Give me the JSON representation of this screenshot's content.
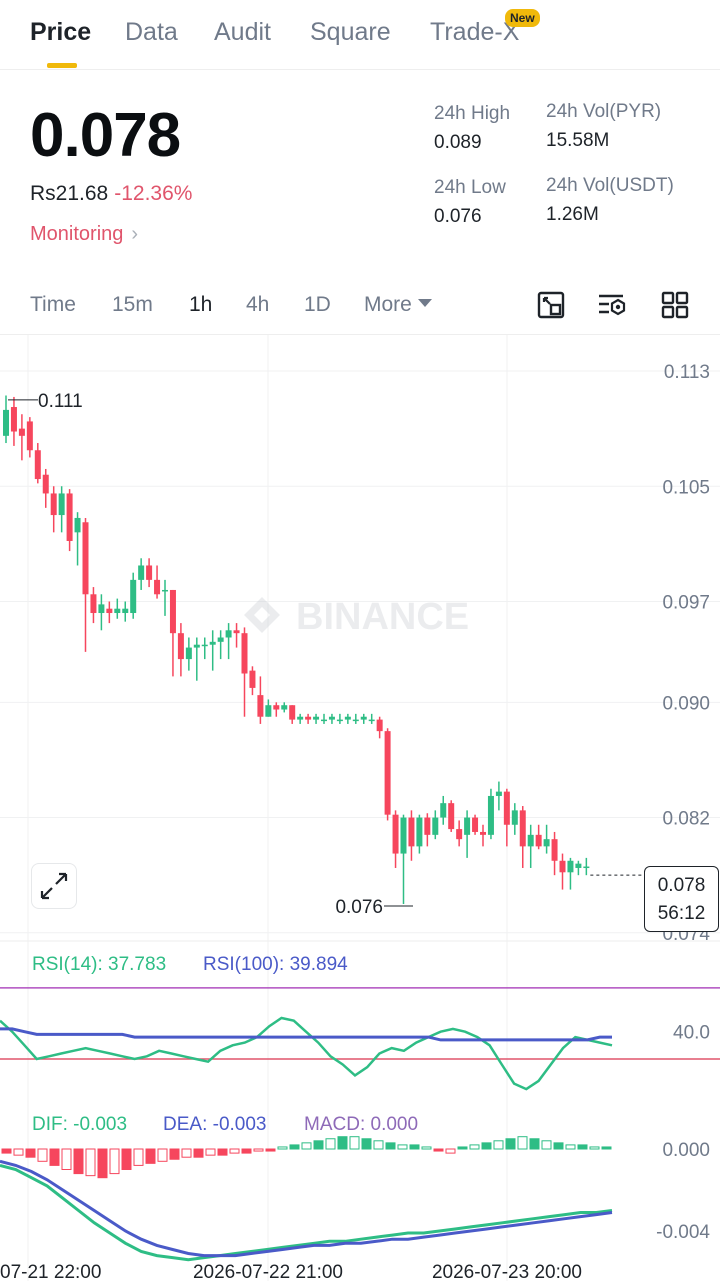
{
  "tabs": [
    {
      "label": "Price",
      "active": true
    },
    {
      "label": "Data",
      "active": false
    },
    {
      "label": "Audit",
      "active": false
    },
    {
      "label": "Square",
      "active": false
    },
    {
      "label": "Trade-X",
      "active": false
    }
  ],
  "new_badge": "New",
  "price": {
    "last": "0.078",
    "fiat": "Rs21.68",
    "change": "-12.36%",
    "monitoring": "Monitoring"
  },
  "stats": {
    "high_label": "24h High",
    "high_value": "0.089",
    "low_label": "24h Low",
    "low_value": "0.076",
    "vol_base_label": "24h Vol(PYR)",
    "vol_base_value": "15.58M",
    "vol_quote_label": "24h Vol(USDT)",
    "vol_quote_value": "1.26M"
  },
  "intervals": [
    {
      "label": "Time",
      "active": false
    },
    {
      "label": "15m",
      "active": false
    },
    {
      "label": "1h",
      "active": true
    },
    {
      "label": "4h",
      "active": false
    },
    {
      "label": "1D",
      "active": false
    },
    {
      "label": "More",
      "active": false
    }
  ],
  "icons": {
    "tool_1": "crop-icon",
    "tool_2": "indicator-settings-icon",
    "tool_3": "grid-layout-icon",
    "expand": "expand-icon"
  },
  "colors": {
    "up": "#2ebd85",
    "down": "#f6465d",
    "accent": "#f0b90b",
    "rsi14": "#2ebd85",
    "rsi100": "#4a5ac8",
    "macd": "#8e6ab8"
  },
  "chart_data": {
    "type": "candlestick",
    "interval": "1h",
    "watermark": "BINANCE",
    "y_ticks": [
      "0.113",
      "0.105",
      "0.097",
      "0.090",
      "0.082",
      "0.074"
    ],
    "ylim": [
      0.0735,
      0.1155
    ],
    "high_marker": "0.111",
    "low_marker": "0.076",
    "last_price_tag": "0.078",
    "countdown": "56:12",
    "x_ticks": [
      "07-21 22:00",
      "2026-07-22 21:00",
      "2026-07-23 20:00"
    ],
    "candles": [
      {
        "o": 0.1085,
        "h": 0.1113,
        "l": 0.108,
        "c": 0.1103
      },
      {
        "o": 0.1105,
        "h": 0.1112,
        "l": 0.1078,
        "c": 0.1088
      },
      {
        "o": 0.109,
        "h": 0.11,
        "l": 0.1068,
        "c": 0.1085
      },
      {
        "o": 0.1095,
        "h": 0.1098,
        "l": 0.107,
        "c": 0.1075
      },
      {
        "o": 0.1075,
        "h": 0.108,
        "l": 0.1052,
        "c": 0.1055
      },
      {
        "o": 0.1058,
        "h": 0.1062,
        "l": 0.1035,
        "c": 0.1045
      },
      {
        "o": 0.1045,
        "h": 0.105,
        "l": 0.1018,
        "c": 0.103
      },
      {
        "o": 0.103,
        "h": 0.105,
        "l": 0.1018,
        "c": 0.1045
      },
      {
        "o": 0.1045,
        "h": 0.1048,
        "l": 0.1005,
        "c": 0.1012
      },
      {
        "o": 0.1018,
        "h": 0.1032,
        "l": 0.0995,
        "c": 0.1028
      },
      {
        "o": 0.1025,
        "h": 0.1028,
        "l": 0.0935,
        "c": 0.0975
      },
      {
        "o": 0.0975,
        "h": 0.098,
        "l": 0.0955,
        "c": 0.0962
      },
      {
        "o": 0.0962,
        "h": 0.0975,
        "l": 0.095,
        "c": 0.0968
      },
      {
        "o": 0.0965,
        "h": 0.097,
        "l": 0.0955,
        "c": 0.0962
      },
      {
        "o": 0.0962,
        "h": 0.0972,
        "l": 0.0958,
        "c": 0.0965
      },
      {
        "o": 0.0962,
        "h": 0.097,
        "l": 0.0956,
        "c": 0.0965
      },
      {
        "o": 0.0962,
        "h": 0.099,
        "l": 0.0958,
        "c": 0.0985
      },
      {
        "o": 0.0985,
        "h": 0.1,
        "l": 0.0978,
        "c": 0.0995
      },
      {
        "o": 0.0995,
        "h": 0.1,
        "l": 0.098,
        "c": 0.0985
      },
      {
        "o": 0.0985,
        "h": 0.0995,
        "l": 0.0972,
        "c": 0.0975
      },
      {
        "o": 0.0978,
        "h": 0.0985,
        "l": 0.096,
        "c": 0.0978
      },
      {
        "o": 0.0978,
        "h": 0.0978,
        "l": 0.0918,
        "c": 0.0948
      },
      {
        "o": 0.0948,
        "h": 0.0955,
        "l": 0.0918,
        "c": 0.093
      },
      {
        "o": 0.093,
        "h": 0.0945,
        "l": 0.0922,
        "c": 0.0938
      },
      {
        "o": 0.0938,
        "h": 0.0945,
        "l": 0.0915,
        "c": 0.094
      },
      {
        "o": 0.094,
        "h": 0.0945,
        "l": 0.093,
        "c": 0.094
      },
      {
        "o": 0.094,
        "h": 0.095,
        "l": 0.0922,
        "c": 0.0942
      },
      {
        "o": 0.0942,
        "h": 0.095,
        "l": 0.093,
        "c": 0.0945
      },
      {
        "o": 0.0945,
        "h": 0.0955,
        "l": 0.093,
        "c": 0.095
      },
      {
        "o": 0.095,
        "h": 0.0955,
        "l": 0.0938,
        "c": 0.0948
      },
      {
        "o": 0.0948,
        "h": 0.0952,
        "l": 0.089,
        "c": 0.092
      },
      {
        "o": 0.0922,
        "h": 0.0925,
        "l": 0.0905,
        "c": 0.091
      },
      {
        "o": 0.0905,
        "h": 0.0918,
        "l": 0.0885,
        "c": 0.089
      },
      {
        "o": 0.089,
        "h": 0.0902,
        "l": 0.089,
        "c": 0.0898
      },
      {
        "o": 0.0898,
        "h": 0.09,
        "l": 0.089,
        "c": 0.0895
      },
      {
        "o": 0.0895,
        "h": 0.09,
        "l": 0.0893,
        "c": 0.0898
      },
      {
        "o": 0.0898,
        "h": 0.0898,
        "l": 0.0885,
        "c": 0.0888
      },
      {
        "o": 0.0888,
        "h": 0.0892,
        "l": 0.0885,
        "c": 0.089
      },
      {
        "o": 0.089,
        "h": 0.0892,
        "l": 0.0885,
        "c": 0.0888
      },
      {
        "o": 0.0888,
        "h": 0.0892,
        "l": 0.0885,
        "c": 0.089
      },
      {
        "o": 0.0888,
        "h": 0.0892,
        "l": 0.0885,
        "c": 0.0888
      },
      {
        "o": 0.0888,
        "h": 0.0892,
        "l": 0.0885,
        "c": 0.089
      },
      {
        "o": 0.0888,
        "h": 0.0892,
        "l": 0.0885,
        "c": 0.0888
      },
      {
        "o": 0.0888,
        "h": 0.0892,
        "l": 0.0885,
        "c": 0.089
      },
      {
        "o": 0.0888,
        "h": 0.0892,
        "l": 0.0885,
        "c": 0.0888
      },
      {
        "o": 0.0888,
        "h": 0.0892,
        "l": 0.0885,
        "c": 0.089
      },
      {
        "o": 0.0888,
        "h": 0.0892,
        "l": 0.0885,
        "c": 0.0888
      },
      {
        "o": 0.0888,
        "h": 0.089,
        "l": 0.0875,
        "c": 0.088
      },
      {
        "o": 0.088,
        "h": 0.0882,
        "l": 0.0818,
        "c": 0.0822
      },
      {
        "o": 0.0822,
        "h": 0.0825,
        "l": 0.0785,
        "c": 0.0795
      },
      {
        "o": 0.0795,
        "h": 0.0822,
        "l": 0.076,
        "c": 0.082
      },
      {
        "o": 0.082,
        "h": 0.0825,
        "l": 0.079,
        "c": 0.08
      },
      {
        "o": 0.08,
        "h": 0.0822,
        "l": 0.0795,
        "c": 0.082
      },
      {
        "o": 0.082,
        "h": 0.0823,
        "l": 0.08,
        "c": 0.0808
      },
      {
        "o": 0.0808,
        "h": 0.0825,
        "l": 0.0805,
        "c": 0.082
      },
      {
        "o": 0.082,
        "h": 0.0835,
        "l": 0.0815,
        "c": 0.083
      },
      {
        "o": 0.083,
        "h": 0.0832,
        "l": 0.081,
        "c": 0.0812
      },
      {
        "o": 0.0812,
        "h": 0.0818,
        "l": 0.08,
        "c": 0.0805
      },
      {
        "o": 0.0808,
        "h": 0.0825,
        "l": 0.0792,
        "c": 0.082
      },
      {
        "o": 0.082,
        "h": 0.0822,
        "l": 0.0808,
        "c": 0.081
      },
      {
        "o": 0.081,
        "h": 0.0815,
        "l": 0.08,
        "c": 0.0808
      },
      {
        "o": 0.0808,
        "h": 0.084,
        "l": 0.0805,
        "c": 0.0835
      },
      {
        "o": 0.0835,
        "h": 0.0845,
        "l": 0.0825,
        "c": 0.0838
      },
      {
        "o": 0.0838,
        "h": 0.084,
        "l": 0.08,
        "c": 0.0815
      },
      {
        "o": 0.0815,
        "h": 0.083,
        "l": 0.0808,
        "c": 0.0825
      },
      {
        "o": 0.0825,
        "h": 0.0828,
        "l": 0.0785,
        "c": 0.08
      },
      {
        "o": 0.08,
        "h": 0.0815,
        "l": 0.0785,
        "c": 0.0808
      },
      {
        "o": 0.0808,
        "h": 0.0815,
        "l": 0.0798,
        "c": 0.08
      },
      {
        "o": 0.08,
        "h": 0.0815,
        "l": 0.0795,
        "c": 0.0805
      },
      {
        "o": 0.0805,
        "h": 0.081,
        "l": 0.078,
        "c": 0.079
      },
      {
        "o": 0.079,
        "h": 0.0795,
        "l": 0.077,
        "c": 0.0782
      },
      {
        "o": 0.0782,
        "h": 0.0792,
        "l": 0.077,
        "c": 0.079
      },
      {
        "o": 0.0785,
        "h": 0.079,
        "l": 0.078,
        "c": 0.0788
      },
      {
        "o": 0.0785,
        "h": 0.0792,
        "l": 0.078,
        "c": 0.0786
      }
    ],
    "rsi": {
      "rsi14_label": "RSI(14): 37.783",
      "rsi100_label": "RSI(100): 39.894",
      "level_label": "40.0",
      "rsi14": [
        44,
        40,
        35,
        30,
        31,
        32,
        33,
        34,
        33,
        32,
        31,
        30,
        31,
        33,
        32,
        31,
        30,
        29,
        33,
        35,
        36,
        38,
        42,
        45,
        44,
        40,
        36,
        31,
        28,
        24,
        27,
        32,
        34,
        33,
        36,
        38,
        40,
        41,
        40,
        38,
        35,
        28,
        21,
        19,
        22,
        28,
        34,
        38,
        37,
        36,
        35
      ],
      "rsi100": [
        41,
        41,
        40,
        39,
        39,
        39,
        39,
        39,
        39,
        39,
        39,
        38,
        38,
        38,
        38,
        38,
        38,
        38,
        38,
        38,
        38,
        38,
        38,
        38,
        38,
        38,
        38,
        38,
        38,
        38,
        38,
        38,
        38,
        38,
        38,
        38,
        37,
        37,
        37,
        37,
        37,
        37,
        37,
        37,
        37,
        37,
        37,
        37,
        37,
        38,
        38
      ]
    },
    "macd": {
      "dif_label": "DIF: -0.003",
      "dea_label": "DEA: -0.003",
      "macd_label": "MACD: 0.000",
      "y_ticks": [
        "0.000",
        "-0.004"
      ],
      "dif": [
        -0.0008,
        -0.001,
        -0.0014,
        -0.0018,
        -0.0024,
        -0.003,
        -0.0036,
        -0.0041,
        -0.0046,
        -0.005,
        -0.0052,
        -0.0053,
        -0.0054,
        -0.0053,
        -0.0052,
        -0.0051,
        -0.005,
        -0.0049,
        -0.0048,
        -0.0047,
        -0.0046,
        -0.0045,
        -0.0045,
        -0.0044,
        -0.0043,
        -0.0042,
        -0.0041,
        -0.0041,
        -0.004,
        -0.0039,
        -0.0038,
        -0.0037,
        -0.0036,
        -0.0035,
        -0.0034,
        -0.0033,
        -0.0032,
        -0.0031,
        -0.0031,
        -0.003
      ],
      "dea": [
        -0.0006,
        -0.0008,
        -0.0011,
        -0.0015,
        -0.002,
        -0.0025,
        -0.003,
        -0.0035,
        -0.004,
        -0.0044,
        -0.0047,
        -0.0049,
        -0.0051,
        -0.0052,
        -0.0052,
        -0.0052,
        -0.0051,
        -0.005,
        -0.0049,
        -0.0048,
        -0.0047,
        -0.0047,
        -0.0046,
        -0.0046,
        -0.0045,
        -0.0044,
        -0.0044,
        -0.0043,
        -0.0042,
        -0.0041,
        -0.004,
        -0.0039,
        -0.0038,
        -0.0037,
        -0.0036,
        -0.0035,
        -0.0034,
        -0.0033,
        -0.0032,
        -0.0031
      ],
      "hist": [
        -0.0002,
        -0.0003,
        -0.0004,
        -0.0006,
        -0.0008,
        -0.001,
        -0.0012,
        -0.0013,
        -0.0014,
        -0.0012,
        -0.001,
        -0.0008,
        -0.0007,
        -0.0006,
        -0.0005,
        -0.0004,
        -0.0004,
        -0.0003,
        -0.0003,
        -0.0002,
        -0.0002,
        -0.0001,
        -0.0001,
        0.0001,
        0.0002,
        0.0003,
        0.0004,
        0.0005,
        0.0006,
        0.0006,
        0.0005,
        0.0004,
        0.0003,
        0.0002,
        0.0002,
        0.0001,
        -0.0001,
        -0.0002,
        0.0001,
        0.0002,
        0.0003,
        0.0004,
        0.0005,
        0.0006,
        0.0005,
        0.0004,
        0.0003,
        0.0002,
        0.0002,
        0.0001,
        0.0001
      ]
    }
  }
}
